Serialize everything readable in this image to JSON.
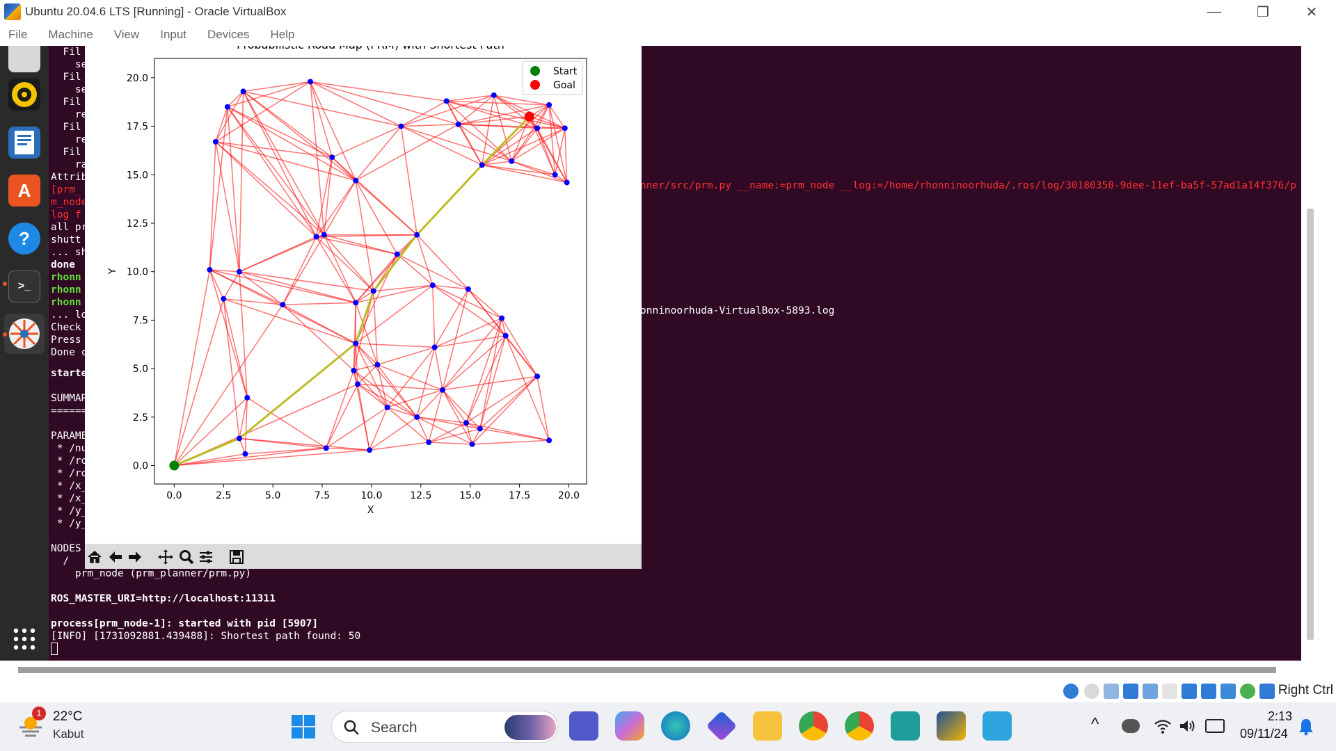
{
  "window": {
    "title": "Ubuntu 20.04.6 LTS [Running] - Oracle VirtualBox",
    "minimize": "—",
    "restore": "❐",
    "close": "✕"
  },
  "menu": [
    "File",
    "Machine",
    "View",
    "Input",
    "Devices",
    "Help"
  ],
  "dock": {
    "icons": [
      "files-icon",
      "rhythmbox-icon",
      "writer-icon",
      "software-icon",
      "help-icon",
      "terminal-icon",
      "prm-app-icon",
      "show-apps-icon"
    ]
  },
  "terminal": {
    "left_lines": [
      {
        "t": "  Fil",
        "y": 0
      },
      {
        "t": "    se",
        "y": 18
      },
      {
        "t": "  Fil",
        "y": 36
      },
      {
        "t": "    se",
        "y": 54
      },
      {
        "t": "  Fil",
        "y": 72
      },
      {
        "t": "    re",
        "y": 90
      },
      {
        "t": "  Fil",
        "y": 108
      },
      {
        "t": "    re",
        "y": 126
      },
      {
        "t": "  Fil",
        "y": 144
      },
      {
        "t": "    ra",
        "y": 162
      },
      {
        "t": "Attrib",
        "y": 180
      }
    ],
    "red_lines": [
      "[prm_",
      "m_node",
      "log f"
    ],
    "white_lines": [
      "all pr",
      "shutt",
      "... sh"
    ],
    "done": "done",
    "green_lines": [
      "rhonn",
      "rhonn",
      "rhonn"
    ],
    "misc_lines": [
      "... lo",
      "Check",
      "Press",
      "Done c"
    ],
    "started": "starte",
    "summary": [
      "SUMMAR",
      "======"
    ],
    "params": [
      "PARAME",
      " * /nu",
      " * /ro",
      " * /ro",
      " * /x_",
      " * /x_",
      " * /y_",
      " * /y_"
    ],
    "nodes": [
      "NODES",
      "  /"
    ],
    "prm_node_line": "    prm_node (prm_planner/prm.py)",
    "ros_master": "ROS_MASTER_URI=http://localhost:11311",
    "process_line": "process[prm_node-1]: started with pid [5907]",
    "info_line": "[INFO] [1731092881.439488]: Shortest path found: 50",
    "right_red": "nner/src/prm.py __name:=prm_node __log:=/home/rhonninoorhuda/.ros/log/30180350-9dee-11ef-ba5f-57ad1a14f376/p",
    "right_log": "onninoorhuda-VirtualBox-5893.log"
  },
  "chart_data": {
    "type": "scatter",
    "title": "Probabilistic Road Map (PRM) with Shortest Path",
    "xlabel": "X",
    "ylabel": "Y",
    "xlim": [
      -1,
      20.9
    ],
    "ylim": [
      -0.95,
      21
    ],
    "xticks": [
      "0.0",
      "2.5",
      "5.0",
      "7.5",
      "10.0",
      "12.5",
      "15.0",
      "17.5",
      "20.0"
    ],
    "yticks": [
      "0.0",
      "2.5",
      "5.0",
      "7.5",
      "10.0",
      "12.5",
      "15.0",
      "17.5",
      "20.0"
    ],
    "legend": {
      "position": "top-right",
      "entries": [
        {
          "label": "Start",
          "color": "#008000"
        },
        {
          "label": "Goal",
          "color": "#ff0000"
        }
      ]
    },
    "start": [
      0,
      0
    ],
    "goal": [
      18,
      18
    ],
    "nodes": [
      [
        2.7,
        18.5
      ],
      [
        3.5,
        19.3
      ],
      [
        6.9,
        19.8
      ],
      [
        2.1,
        16.7
      ],
      [
        8.0,
        15.9
      ],
      [
        9.2,
        14.7
      ],
      [
        11.5,
        17.5
      ],
      [
        13.8,
        18.8
      ],
      [
        14.4,
        17.6
      ],
      [
        16.2,
        19.1
      ],
      [
        18.4,
        17.4
      ],
      [
        19.0,
        18.6
      ],
      [
        19.8,
        17.4
      ],
      [
        17.1,
        15.7
      ],
      [
        15.6,
        15.5
      ],
      [
        19.3,
        15.0
      ],
      [
        19.9,
        14.6
      ],
      [
        7.2,
        11.8
      ],
      [
        7.6,
        11.9
      ],
      [
        12.3,
        11.9
      ],
      [
        11.3,
        10.9
      ],
      [
        1.8,
        10.1
      ],
      [
        3.3,
        10.0
      ],
      [
        9.2,
        8.4
      ],
      [
        10.1,
        9.0
      ],
      [
        13.1,
        9.3
      ],
      [
        14.9,
        9.1
      ],
      [
        2.5,
        8.6
      ],
      [
        5.5,
        8.3
      ],
      [
        16.6,
        7.6
      ],
      [
        16.8,
        6.7
      ],
      [
        9.2,
        6.3
      ],
      [
        13.2,
        6.1
      ],
      [
        18.4,
        4.6
      ],
      [
        9.1,
        4.9
      ],
      [
        9.3,
        4.2
      ],
      [
        10.3,
        5.2
      ],
      [
        3.7,
        3.5
      ],
      [
        13.6,
        3.9
      ],
      [
        10.8,
        3.0
      ],
      [
        12.3,
        2.5
      ],
      [
        14.8,
        2.2
      ],
      [
        15.5,
        1.9
      ],
      [
        3.3,
        1.4
      ],
      [
        7.7,
        0.9
      ],
      [
        9.9,
        0.8
      ],
      [
        12.9,
        1.2
      ],
      [
        15.1,
        1.1
      ],
      [
        19.0,
        1.3
      ],
      [
        3.6,
        0.6
      ]
    ],
    "shortest_path": [
      [
        0,
        0
      ],
      [
        3.3,
        1.4
      ],
      [
        9.2,
        6.3
      ],
      [
        10.1,
        9.0
      ],
      [
        12.3,
        11.9
      ],
      [
        15.6,
        15.5
      ],
      [
        18,
        18
      ]
    ]
  },
  "fig_toolbar": [
    "home-icon",
    "back-icon",
    "forward-icon",
    "pan-icon",
    "zoom-icon",
    "configure-icon",
    "save-icon"
  ],
  "statusbar": {
    "host_key": "Right Ctrl"
  },
  "taskbar": {
    "weather_badge": "1",
    "weather_temp": "22°C",
    "weather_desc": "Kabut",
    "search_placeholder": "Search",
    "time": "2:13",
    "date": "09/11/24",
    "chevron": "^"
  }
}
